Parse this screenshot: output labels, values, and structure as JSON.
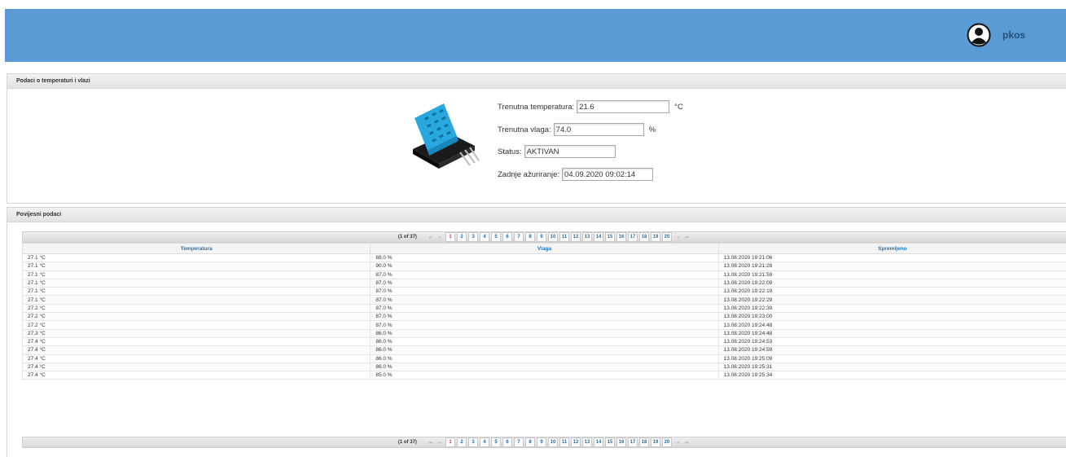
{
  "user": {
    "name": "pkos"
  },
  "current_panel": {
    "title": "Podaci o temperaturi i vlazi",
    "temperature": {
      "label": "Trenutna temperatura:",
      "value": "21.6",
      "unit": "°C"
    },
    "humidity": {
      "label": "Trenutna vlaga:",
      "value": "74.0",
      "unit": "%"
    },
    "status": {
      "label": "Status:",
      "value": "AKTIVAN"
    },
    "updated": {
      "label": "Zadnje ažuriranje:",
      "value": "04.09.2020 09:02:14"
    }
  },
  "history_panel": {
    "title": "Povijesni podaci",
    "page_report": "(1 of 37)",
    "pages": [
      "1",
      "2",
      "3",
      "4",
      "5",
      "6",
      "7",
      "8",
      "9",
      "10",
      "11",
      "12",
      "13",
      "14",
      "15",
      "16",
      "17",
      "18",
      "19",
      "20"
    ],
    "active_page": "1",
    "nav": {
      "first": "⇤",
      "prev": "⇠",
      "next": "⇢",
      "last": "⇥"
    },
    "columns": [
      "Temperatura",
      "Vlaga",
      "Spremljeno"
    ],
    "rows": [
      [
        "27.1 °C",
        "88.0 %",
        "13.08.2020 19:21:06"
      ],
      [
        "27.1 °C",
        "90.0 %",
        "13.08.2020 19:21:28"
      ],
      [
        "27.1 °C",
        "87.0 %",
        "13.08.2020 19:21:59"
      ],
      [
        "27.1 °C",
        "87.0 %",
        "13.08.2020 19:22:09"
      ],
      [
        "27.1 °C",
        "87.0 %",
        "13.08.2020 19:22:19"
      ],
      [
        "27.1 °C",
        "87.0 %",
        "13.08.2020 19:22:29"
      ],
      [
        "27.2 °C",
        "87.0 %",
        "13.08.2020 19:22:39"
      ],
      [
        "27.2 °C",
        "87.0 %",
        "13.08.2020 19:23:00"
      ],
      [
        "27.2 °C",
        "87.0 %",
        "13.08.2020 19:24:48"
      ],
      [
        "27.3 °C",
        "86.0 %",
        "13.08.2020 19:24:48"
      ],
      [
        "27.4 °C",
        "86.0 %",
        "13.08.2020 19:24:53"
      ],
      [
        "27.4 °C",
        "86.0 %",
        "13.08.2020 19:24:59"
      ],
      [
        "27.4 °C",
        "86.0 %",
        "13.08.2020 19:25:09"
      ],
      [
        "27.4 °C",
        "86.0 %",
        "13.08.2020 19:25:31"
      ],
      [
        "27.4 °C",
        "85.0 %",
        "13.08.2020 19:25:34"
      ]
    ]
  },
  "colors": {
    "topbar": "#5b9bd5",
    "link": "#1e73be",
    "active_page": "#e0245e"
  },
  "icons": {
    "user": "user-circle-icon",
    "sensor": "dht11-sensor-image"
  }
}
